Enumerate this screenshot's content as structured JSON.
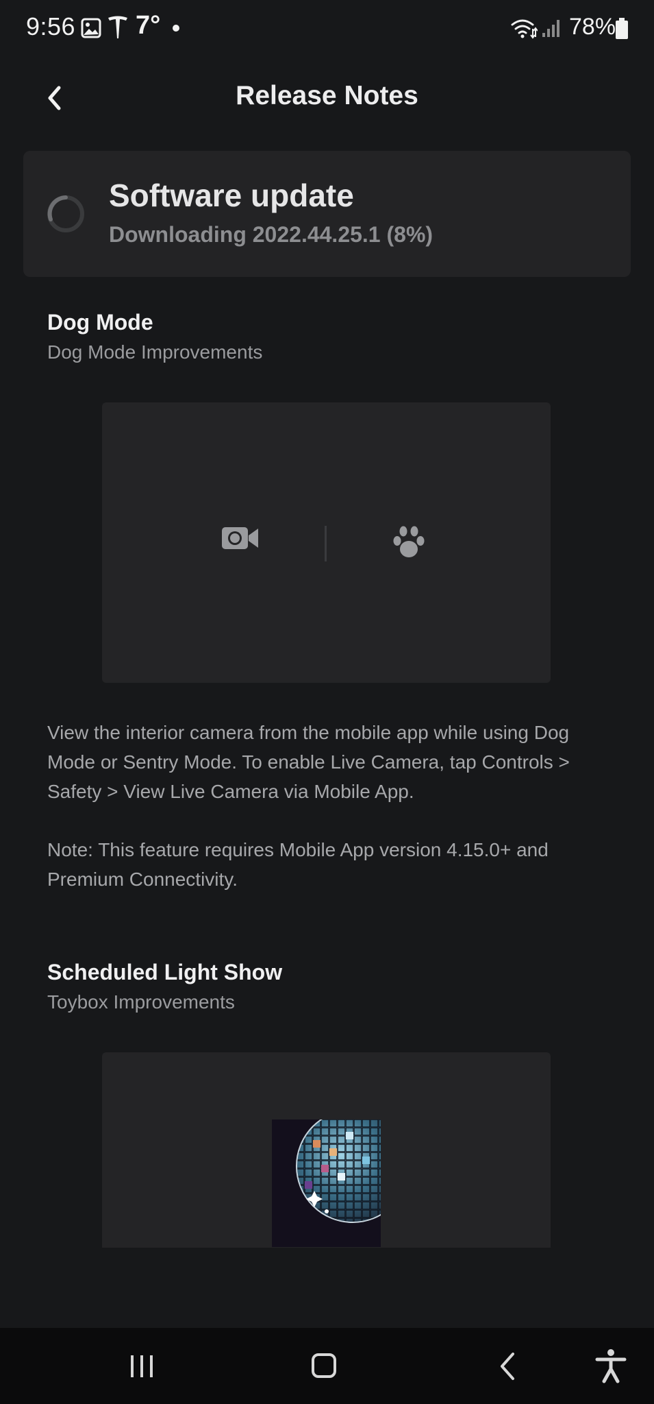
{
  "status_bar": {
    "time": "9:56",
    "temperature": "7°",
    "battery": "78%",
    "icons": [
      "gallery-icon",
      "tesla-icon",
      "notification-dot",
      "wifi-icon",
      "signal-icon",
      "battery-icon"
    ]
  },
  "header": {
    "title": "Release Notes",
    "back_icon": "chevron-left-icon"
  },
  "update": {
    "title": "Software update",
    "status": "Downloading 2022.44.25.1 (8%)",
    "progress_percent": 8
  },
  "sections": [
    {
      "title": "Dog Mode",
      "subtitle": "Dog Mode Improvements",
      "media_icons": [
        "camera-icon",
        "paw-icon"
      ],
      "paragraphs": [
        "View the interior camera from the mobile app while using Dog Mode or Sentry Mode. To enable Live Camera, tap Controls > Safety > View Live Camera via Mobile App.",
        "Note: This feature requires Mobile App version 4.15.0+ and Premium Connectivity."
      ]
    },
    {
      "title": "Scheduled Light Show",
      "subtitle": "Toybox Improvements",
      "media_image": "disco-ball-image"
    }
  ],
  "nav": {
    "items": [
      "recent-apps-icon",
      "home-icon",
      "back-icon",
      "accessibility-icon"
    ]
  },
  "colors": {
    "background": "#17181a",
    "card": "#232325",
    "text_primary": "#ededee",
    "text_secondary": "#9b9c9f",
    "nav_background": "#0b0b0c"
  }
}
